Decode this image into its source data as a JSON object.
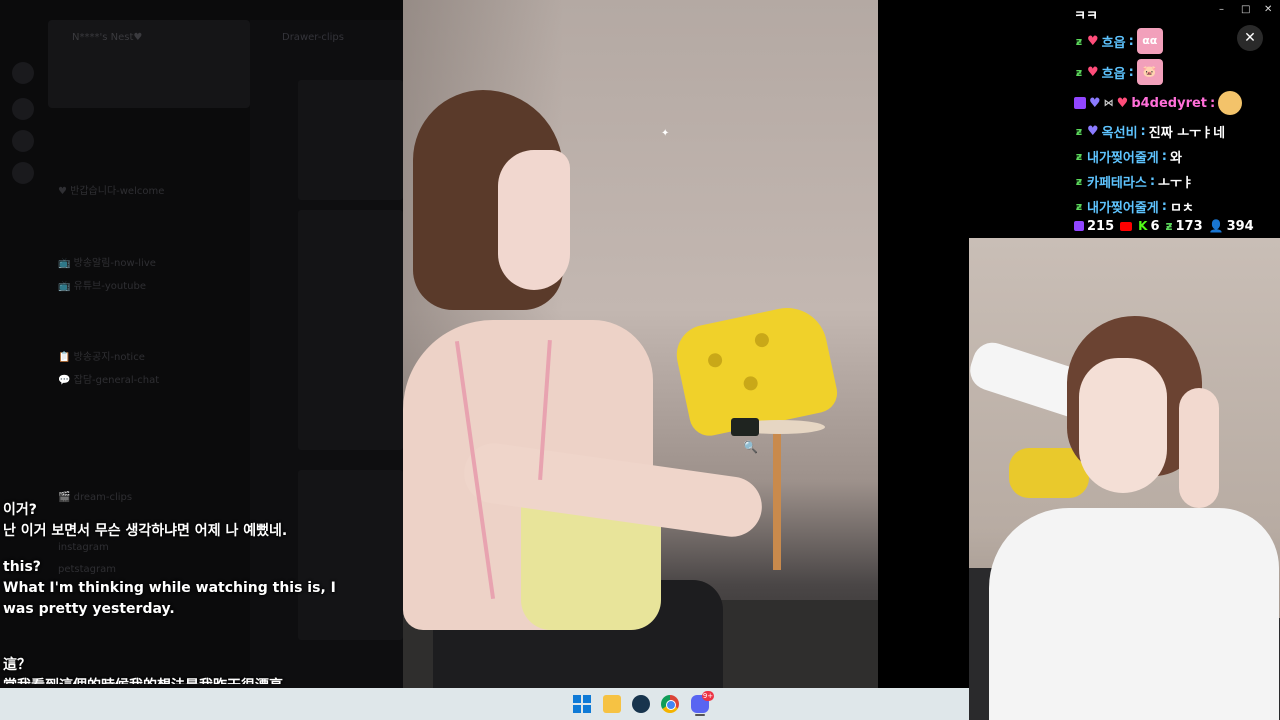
{
  "discord_background": {
    "server_name": "N****'s Nest♥",
    "drawer_title": "Drawer-clips",
    "channels": [
      "♥ 반갑습니다-welcome",
      "📺 방송알림-now-live",
      "📺 유튜브-youtube",
      "📋 방송공지-notice",
      "💬 잡담-general-chat",
      "🎬 dream-clips",
      "instagram",
      "petstagram"
    ]
  },
  "subtitles": {
    "lines": [
      "이거?",
      "난 이거 보면서 무슨 생각하냐면 어제 나 예뻤네.",
      "",
      "this?",
      "What I'm thinking while watching this is, I",
      "was pretty yesterday.",
      "",
      "這？",
      "當我看到這個的時候我的想法是我昨天很漂亮"
    ]
  },
  "chat": {
    "top_partial": "ㅋㅋ",
    "messages": [
      {
        "platform": "chzzk",
        "badge": "heart",
        "user": "흐읍",
        "message": "",
        "emote_text": "αα"
      },
      {
        "platform": "chzzk",
        "badge": "heart",
        "user": "흐읍",
        "message": "",
        "emote_text": "🐷"
      },
      {
        "platform": "twitch",
        "badge": "heart",
        "user": "b4dedyret",
        "message": "",
        "emote_text": ""
      },
      {
        "platform": "chzzk",
        "badge": "heart-purple",
        "user": "옥선비",
        "message": "진짜 ㅗㅜㅑ네",
        "emote_text": ""
      },
      {
        "platform": "chzzk",
        "badge": "",
        "user": "내가찢어줄게",
        "message": "와",
        "emote_text": ""
      },
      {
        "platform": "chzzk",
        "badge": "",
        "user": "카페테라스",
        "message": "ㅗㅜㅑ",
        "emote_text": ""
      },
      {
        "platform": "chzzk",
        "badge": "",
        "user": "내가찢어줄게",
        "message": "ㅁㅊ",
        "emote_text": ""
      }
    ],
    "stats": {
      "twitch": "215",
      "kick": "6",
      "chzzk": "173",
      "total": "394"
    }
  },
  "window_controls": {
    "minimize": "–",
    "maximize": "□",
    "close": "✕",
    "overlay_close": "✕"
  },
  "taskbar": {
    "icons": [
      "windows-start",
      "file-explorer",
      "steam",
      "chrome",
      "discord"
    ],
    "discord_badge": "9+"
  }
}
